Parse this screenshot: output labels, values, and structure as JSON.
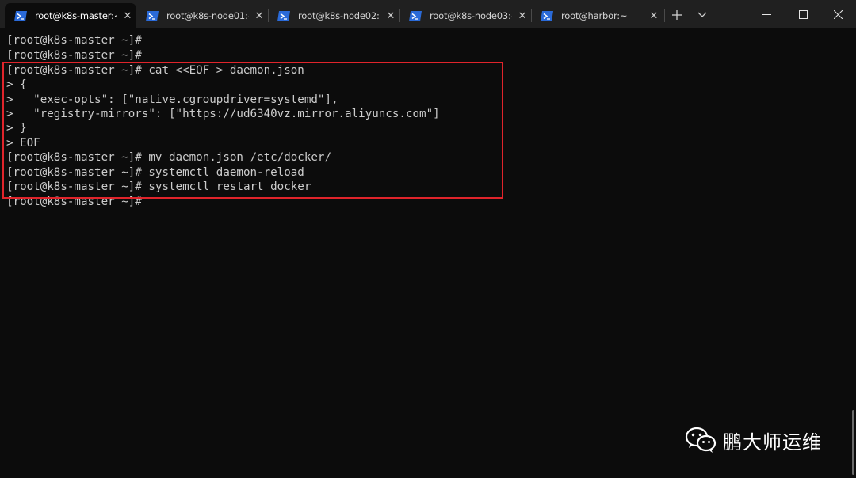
{
  "tabs": [
    {
      "title": "root@k8s-master:~",
      "active": true
    },
    {
      "title": "root@k8s-node01:~",
      "active": false
    },
    {
      "title": "root@k8s-node02:~",
      "active": false
    },
    {
      "title": "root@k8s-node03:~",
      "active": false
    },
    {
      "title": "root@harbor:~",
      "active": false
    }
  ],
  "window": {
    "new_tab_icon": "plus-icon",
    "dropdown_icon": "chevron-down-icon",
    "minimize_icon": "minimize-icon",
    "maximize_icon": "maximize-icon",
    "close_icon": "close-icon"
  },
  "terminal": {
    "lines": [
      "[root@k8s-master ~]#",
      "[root@k8s-master ~]#",
      "[root@k8s-master ~]# cat <<EOF > daemon.json",
      "> {",
      ">   \"exec-opts\": [\"native.cgroupdriver=systemd\"],",
      ">   \"registry-mirrors\": [\"https://ud6340vz.mirror.aliyuncs.com\"]",
      "> }",
      "> EOF",
      "[root@k8s-master ~]# mv daemon.json /etc/docker/",
      "[root@k8s-master ~]# systemctl daemon-reload",
      "[root@k8s-master ~]# systemctl restart docker",
      "[root@k8s-master ~]#"
    ],
    "highlight_color": "#e0242b"
  },
  "watermark": {
    "text": "鹏大师运维",
    "icon": "wechat-icon"
  }
}
